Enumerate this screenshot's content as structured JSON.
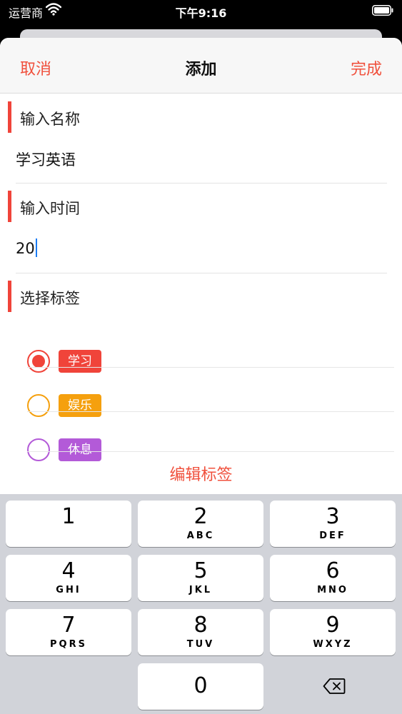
{
  "status_bar": {
    "carrier": "运营商",
    "time": "下午9:16"
  },
  "nav": {
    "cancel": "取消",
    "title": "添加",
    "done": "完成"
  },
  "form": {
    "name_label": "输入名称",
    "name_value": "学习英语",
    "time_label": "输入时间",
    "time_value": "20",
    "tags_label": "选择标签"
  },
  "tags": [
    {
      "label": "学习",
      "color": "#f0443a",
      "selected": true
    },
    {
      "label": "娱乐",
      "color": "#f5a00e",
      "selected": false
    },
    {
      "label": "休息",
      "color": "#b35ad8",
      "selected": false
    }
  ],
  "edit_tags": "编辑标签",
  "keyboard": {
    "keys": [
      {
        "digit": "1",
        "letters": ""
      },
      {
        "digit": "2",
        "letters": "ABC"
      },
      {
        "digit": "3",
        "letters": "DEF"
      },
      {
        "digit": "4",
        "letters": "GHI"
      },
      {
        "digit": "5",
        "letters": "JKL"
      },
      {
        "digit": "6",
        "letters": "MNO"
      },
      {
        "digit": "7",
        "letters": "PQRS"
      },
      {
        "digit": "8",
        "letters": "TUV"
      },
      {
        "digit": "9",
        "letters": "WXYZ"
      },
      {
        "digit": "0",
        "letters": ""
      }
    ]
  },
  "icons": {
    "wifi": "wifi-icon",
    "battery": "battery-icon",
    "delete": "delete-backspace-icon"
  }
}
